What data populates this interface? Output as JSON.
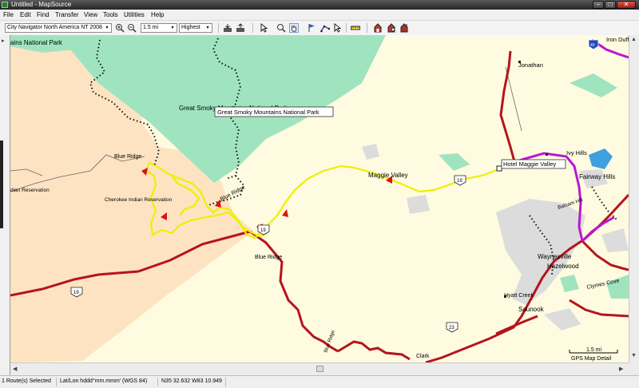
{
  "window": {
    "title": "Untitled - MapSource",
    "minimize_glyph": "–",
    "maximize_glyph": "□",
    "close_glyph": "✕"
  },
  "menu": [
    "File",
    "Edit",
    "Find",
    "Transfer",
    "View",
    "Tools",
    "Utilities",
    "Help"
  ],
  "toolbar": {
    "map_product": "City Navigator North America NT 2008",
    "zoom_level": "1.5 mi",
    "detail_level": "Highest",
    "dropdown_glyph": "▾",
    "icons": [
      "zoom-in-icon",
      "zoom-out-icon",
      "receive-from-device-icon",
      "send-to-device-icon",
      "select-tool-icon",
      "zoom-tool-icon",
      "hand-tool-icon",
      "waypoint-tool-icon",
      "route-tool-icon",
      "track-tool-icon",
      "measure-distance-icon",
      "map-area-tool-icon",
      "find-places-icon",
      "home-icon"
    ]
  },
  "map": {
    "labels": {
      "park_top_left": "ains National Park",
      "park_center": "Great Smoky Mountains National Park",
      "park_popup": "Great Smoky Mountains National Park",
      "blue_ridge_1": "Blue Ridge",
      "blue_ridge_2": "Blue Ridge",
      "blue_ridge_3": "Blue Ridge",
      "blue_ridge_4": "Blue Ridge",
      "indian_reservation": "dian Reservation",
      "cherokee": "Cherokee Indian Reservation",
      "maggie_valley": "Maggie Valley",
      "hotel": "Hotel Maggie Valley",
      "jonathan": "Jonathan",
      "iron_duff": "Iron Duff",
      "ivy_hills": "Ivy Hills",
      "fairway_hills": "Fairway Hills",
      "waynesville": "Waynesville",
      "hazelwood": "Hazelwood",
      "hyatt_creek": "Hyatt Creek",
      "saunook": "Saunook",
      "clymes_cove": "Clymes Cove",
      "balsam": "Balsam Hill",
      "clark": "Clark",
      "route19_a": "19",
      "route19_b": "19",
      "route19_c": "19",
      "route23": "23",
      "interstate": "40",
      "scale_value": "1.5 mi",
      "scale_caption": "GPS Map Detail"
    },
    "colors": {
      "background": "#fffbe0",
      "park": "#9fe4bf",
      "reservation": "#fde3c2",
      "urban": "#dcdcdc",
      "water": "#3fa0e0",
      "highway": "#b5141c",
      "interstate": "#b818d2",
      "route": "#e8e800",
      "dotted_trail": "#111111"
    }
  },
  "scroll": {
    "up_glyph": "▲",
    "down_glyph": "▼",
    "left_glyph": "◀",
    "right_glyph": "▶",
    "collapse_glyph": "▸"
  },
  "status": {
    "selection": "1 Route(s) Selected",
    "position_format": "Lat/Lon hddd°mm.mmm' (WGS 84)",
    "coordinates": "N35 32.632 W83 10.949"
  }
}
